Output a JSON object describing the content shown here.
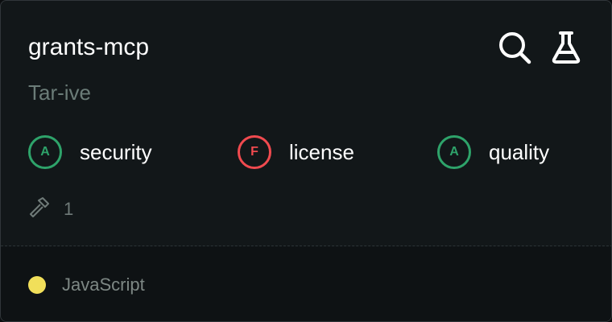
{
  "card": {
    "title": "grants-mcp",
    "author": "Tar-ive",
    "actions": {
      "search_icon": "search-icon",
      "flask_icon": "flask-icon"
    },
    "scores": [
      {
        "grade": "A",
        "label": "security",
        "color": "#2ea36a"
      },
      {
        "grade": "F",
        "label": "license",
        "color": "#f04a4f"
      },
      {
        "grade": "A",
        "label": "quality",
        "color": "#2ea36a"
      }
    ],
    "tools": {
      "icon": "hammer-icon",
      "count": "1"
    },
    "language": {
      "name": "JavaScript",
      "color": "#f1df5a"
    }
  }
}
